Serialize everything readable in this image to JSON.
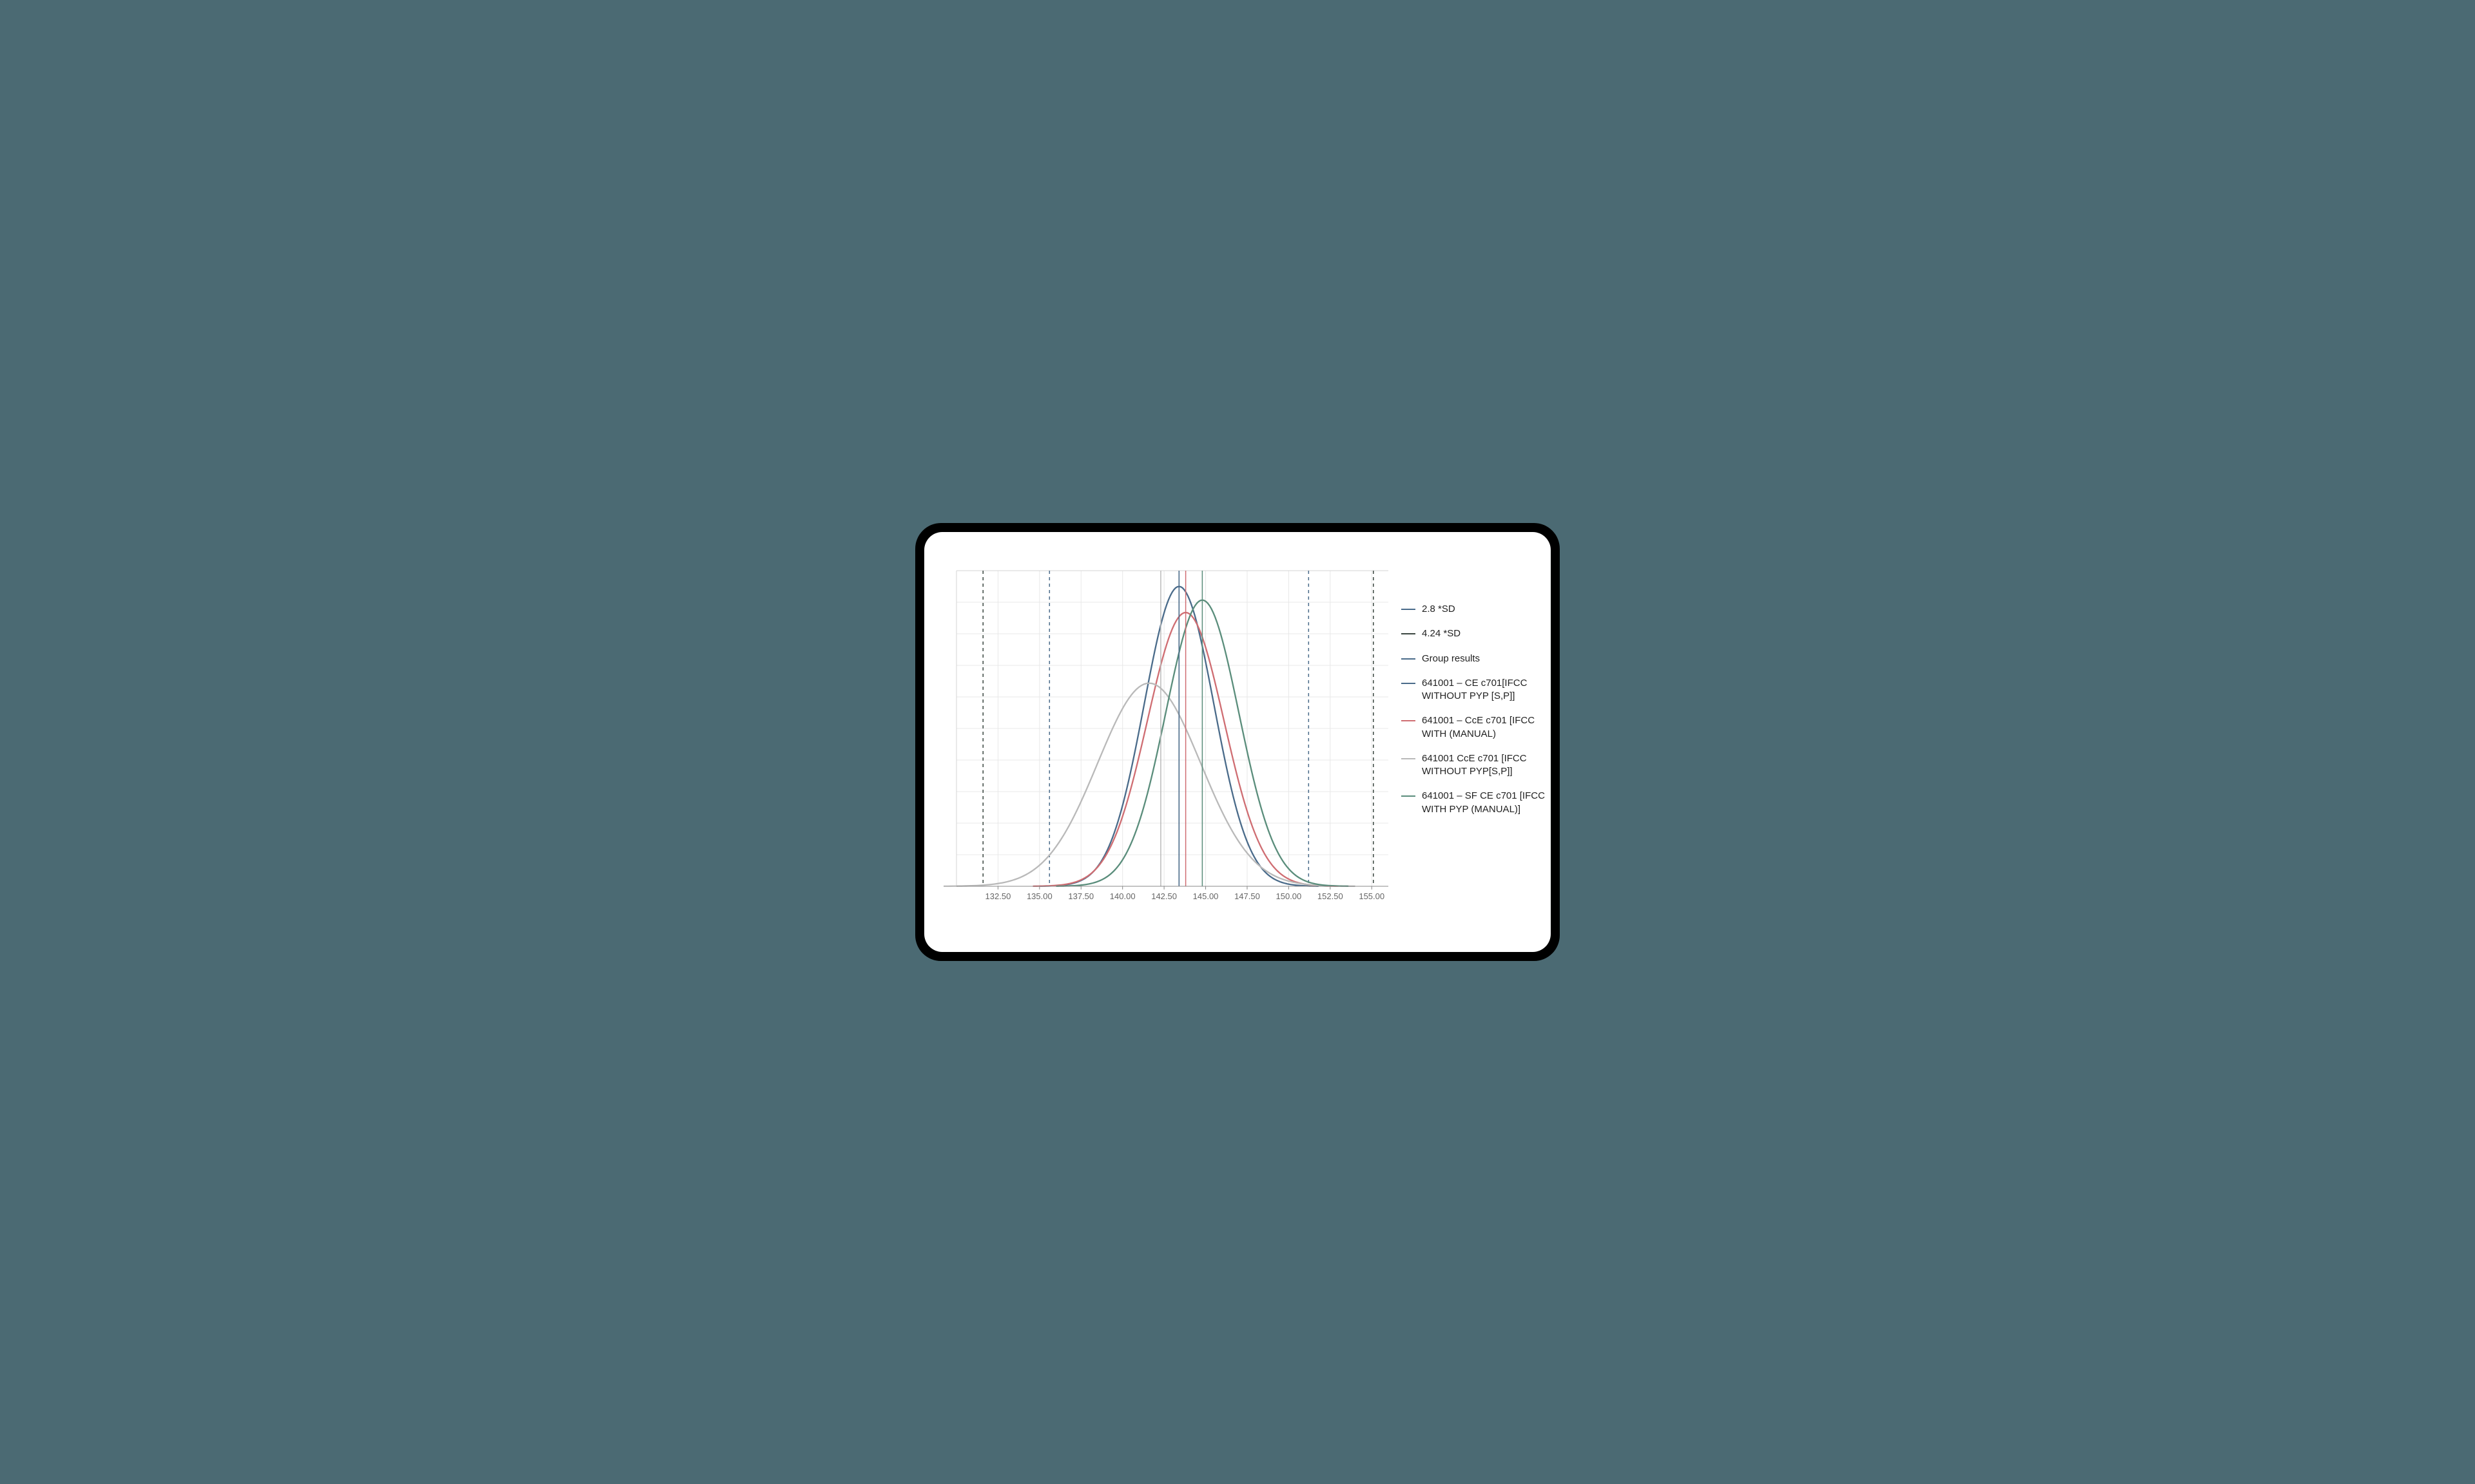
{
  "chart_data": {
    "type": "line",
    "xlabel": "",
    "ylabel": "",
    "x_ticks": [
      132.5,
      135.0,
      137.5,
      140.0,
      142.5,
      145.0,
      147.5,
      150.0,
      152.5,
      155.0
    ],
    "x_range": [
      130.0,
      156.0
    ],
    "reference_lines": [
      {
        "name": "2.8 *SD",
        "values": [
          135.6,
          151.2
        ],
        "color": "#4a6b8a",
        "dash": true
      },
      {
        "name": "4.24 *SD",
        "values": [
          131.6,
          155.1
        ],
        "color": "#3a4640",
        "dash": true
      },
      {
        "name": "Group results",
        "values": [
          143.4
        ],
        "color": "#4a6b8a",
        "dash": false
      }
    ],
    "series": [
      {
        "name": "641001 – CE c701[IFCC WITHOUT PYP [S,P]]",
        "mean": 143.4,
        "sd": 2.1,
        "color": "#4a6b8a"
      },
      {
        "name": "641001 – CcE c701 [IFCC WITH (MANUAL)",
        "mean": 143.8,
        "sd": 2.3,
        "color": "#cf6d72"
      },
      {
        "name": "641001 CcE c701 [IFCC WITHOUT PYP[S,P]]",
        "mean": 141.6,
        "sd": 3.1,
        "color": "#b9b9b9"
      },
      {
        "name": "641001 – SF CE c701 [IFCC WITH PYP (MANUAL)]",
        "mean": 144.8,
        "sd": 2.2,
        "color": "#5a8d7b"
      }
    ],
    "mean_markers": [
      {
        "value": 142.3,
        "color": "#b9b9b9"
      },
      {
        "value": 143.4,
        "color": "#4a6b8a"
      },
      {
        "value": 143.8,
        "color": "#cf6d72"
      },
      {
        "value": 144.8,
        "color": "#5a8d7b"
      }
    ]
  },
  "legend": {
    "items": [
      {
        "label": "2.8 *SD",
        "color": "#4a6b8a"
      },
      {
        "label": "4.24 *SD",
        "color": "#3a4640"
      },
      {
        "label": "Group results",
        "color": "#4a6b8a"
      },
      {
        "label": "641001 – CE c701[IFCC WITHOUT PYP [S,P]]",
        "color": "#4a6b8a"
      },
      {
        "label": "641001 – CcE c701 [IFCC WITH (MANUAL)",
        "color": "#cf6d72"
      },
      {
        "label": "641001 CcE c701 [IFCC WITHOUT PYP[S,P]]",
        "color": "#b9b9b9"
      },
      {
        "label": "641001 – SF CE c701 [IFCC WITH PYP (MANUAL)]",
        "color": "#5a8d7b"
      }
    ]
  }
}
